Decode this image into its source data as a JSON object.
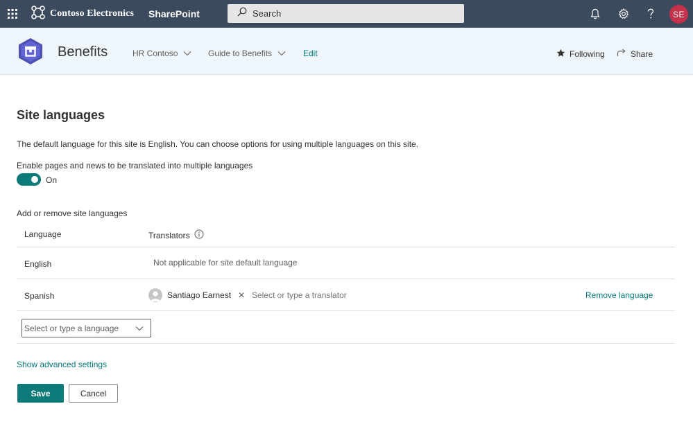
{
  "suite_bar": {
    "waffle_icon": "app-launcher-icon",
    "brand_name": "Contoso Electronics",
    "app_name": "SharePoint",
    "search": {
      "placeholder": "Search"
    },
    "icons": [
      "bell-icon",
      "gear-icon",
      "help-icon"
    ],
    "avatar_initials": "SE",
    "colors": {
      "bar": "#3b4a5c",
      "avatar": "#c4314b"
    }
  },
  "site_header": {
    "title": "Benefits",
    "nav": [
      {
        "label": "HR Contoso",
        "has_dropdown": true
      },
      {
        "label": "Guide to Benefits",
        "has_dropdown": true
      },
      {
        "label": "Edit",
        "has_dropdown": false
      }
    ],
    "actions": {
      "following_label": "Following",
      "share_label": "Share"
    }
  },
  "page": {
    "heading": "Site languages",
    "description": "The default language for this site is English. You can choose options for using multiple languages on this site.",
    "toggle": {
      "label": "Enable pages and news to be translated into multiple languages",
      "state": "On",
      "on": true
    },
    "languages_section_label": "Add or remove site languages",
    "table": {
      "headers": {
        "language": "Language",
        "translators": "Translators"
      },
      "rows": [
        {
          "language": "English",
          "translators_text": "Not applicable for site default language"
        },
        {
          "language": "Spanish",
          "translator_name": "Santiago Earnest",
          "translator_placeholder": "Select or type a translator",
          "action": "Remove language"
        }
      ]
    },
    "language_picker": {
      "placeholder": "Select or type a language"
    },
    "advanced_link": "Show advanced settings",
    "buttons": {
      "save": "Save",
      "cancel": "Cancel"
    },
    "accent_color": "#0b7a78"
  }
}
